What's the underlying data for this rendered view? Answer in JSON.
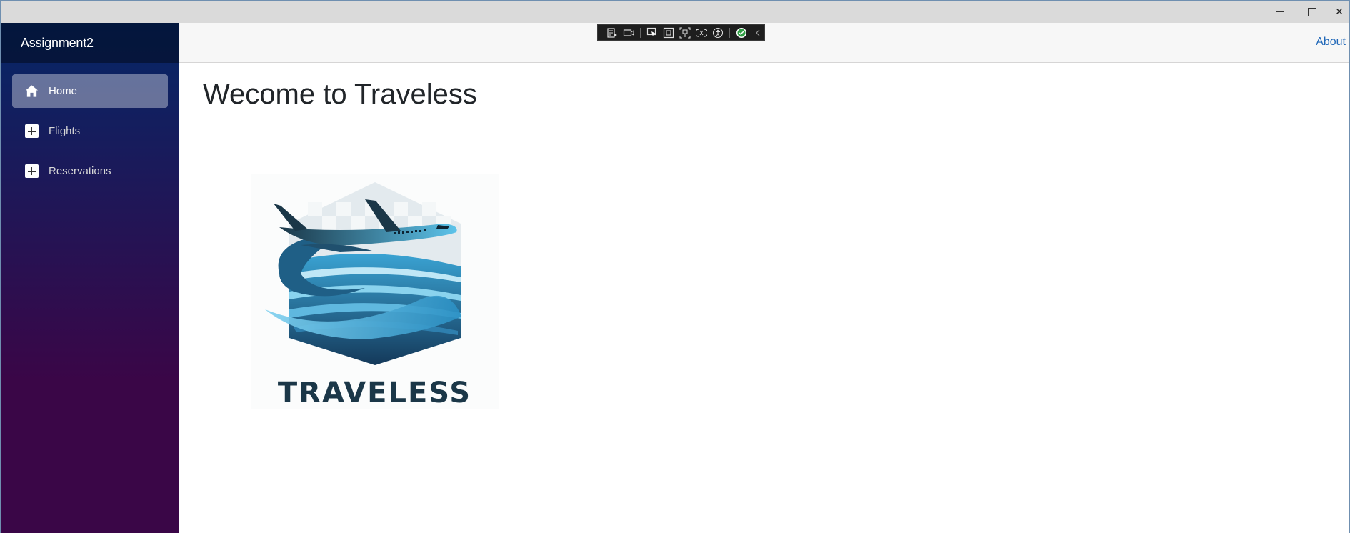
{
  "window": {
    "minimize_label": "",
    "close_glyph": "✕"
  },
  "sidebar": {
    "brand": "Assignment2",
    "items": [
      {
        "label": "Home",
        "icon": "home-icon",
        "active": true
      },
      {
        "label": "Flights",
        "icon": "plus-square-icon",
        "active": false
      },
      {
        "label": "Reservations",
        "icon": "plus-square-icon",
        "active": false
      }
    ]
  },
  "topbar": {
    "about_label": "About"
  },
  "main": {
    "title": "Wecome to Traveless",
    "logo_text": "TRAVELESS"
  },
  "colors": {
    "sidebar_top": "#052767",
    "sidebar_bottom": "#3a0647",
    "link": "#2168b8",
    "logo_dark": "#1b3748",
    "logo_blue": "#3aa3d3"
  }
}
